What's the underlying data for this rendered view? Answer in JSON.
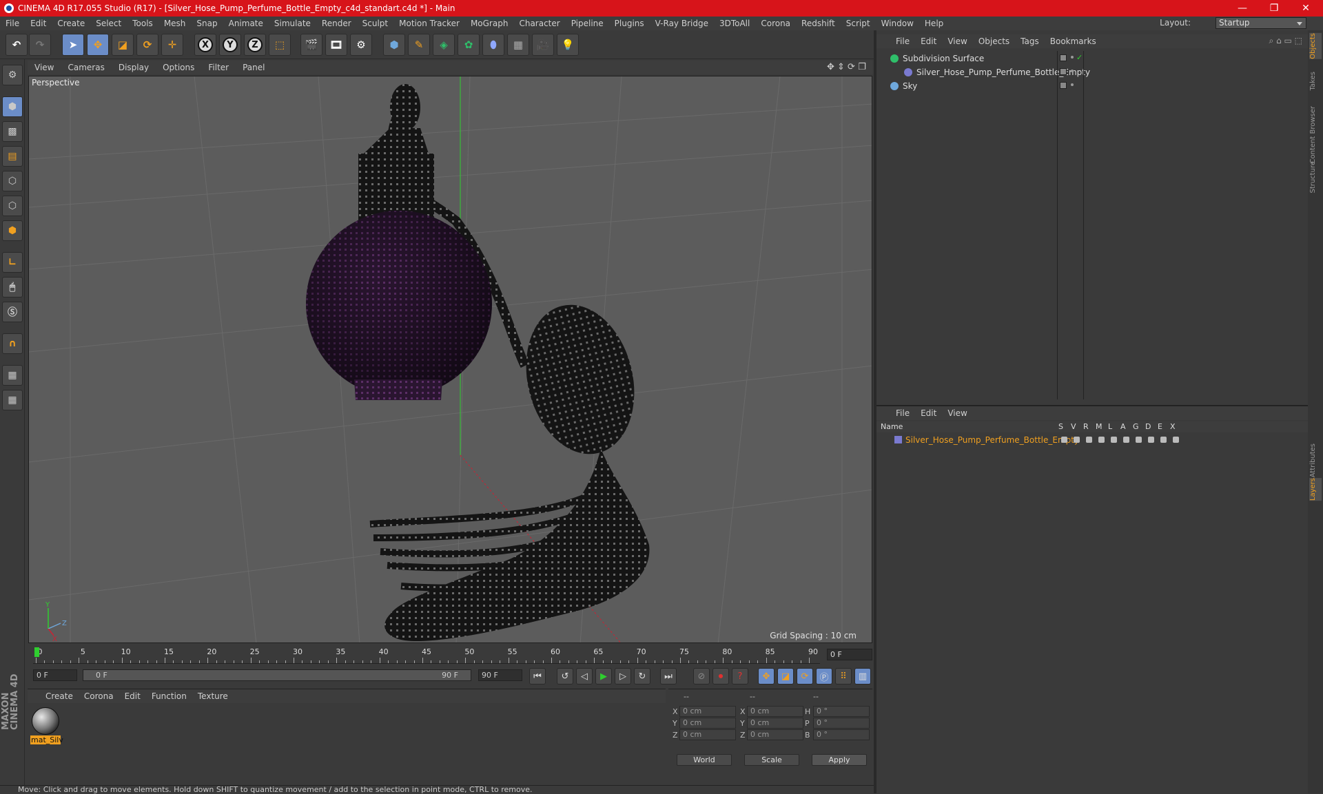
{
  "window": {
    "title": "CINEMA 4D R17.055 Studio (R17) - [Silver_Hose_Pump_Perfume_Bottle_Empty_c4d_standart.c4d *] - Main",
    "minimize": "—",
    "maximize": "❐",
    "close": "✕"
  },
  "menu": [
    "File",
    "Edit",
    "Create",
    "Select",
    "Tools",
    "Mesh",
    "Snap",
    "Animate",
    "Simulate",
    "Render",
    "Sculpt",
    "Motion Tracker",
    "MoGraph",
    "Character",
    "Pipeline",
    "Plugins",
    "V-Ray Bridge",
    "3DToAll",
    "Corona",
    "Redshift",
    "Script",
    "Window",
    "Help"
  ],
  "layout": {
    "label": "Layout:",
    "value": "Startup"
  },
  "toolbar": {
    "x_axis": "X",
    "y_axis": "Y",
    "z_axis": "Z"
  },
  "viewport": {
    "menu": [
      "View",
      "Cameras",
      "Display",
      "Options",
      "Filter",
      "Panel"
    ],
    "label": "Perspective",
    "grid_spacing": "Grid Spacing : 10 cm",
    "axis_x": "X",
    "axis_y": "Y",
    "axis_z": "Z"
  },
  "timeline": {
    "ticks": [
      "0",
      "5",
      "10",
      "15",
      "20",
      "25",
      "30",
      "35",
      "40",
      "45",
      "50",
      "55",
      "60",
      "65",
      "70",
      "75",
      "80",
      "85",
      "90"
    ],
    "current_frame": "0 F",
    "start_field": "0 F",
    "range_start": "0 F",
    "range_end": "90 F",
    "end_field": "90 F"
  },
  "material_manager": {
    "menu": [
      "Create",
      "Corona",
      "Edit",
      "Function",
      "Texture"
    ],
    "material_name": "mat_Silv"
  },
  "coordinates": {
    "header": [
      "--",
      "--",
      "--"
    ],
    "rows": [
      {
        "l1": "X",
        "v1": "0 cm",
        "l2": "X",
        "v2": "0 cm",
        "l3": "H",
        "v3": "0 °"
      },
      {
        "l1": "Y",
        "v1": "0 cm",
        "l2": "Y",
        "v2": "0 cm",
        "l3": "P",
        "v3": "0 °"
      },
      {
        "l1": "Z",
        "v1": "0 cm",
        "l2": "Z",
        "v2": "0 cm",
        "l3": "B",
        "v3": "0 °"
      }
    ],
    "mode": "World",
    "size_mode": "Scale",
    "apply": "Apply"
  },
  "status": "Move: Click and drag to move elements. Hold down SHIFT to quantize movement / add to the selection in point mode, CTRL to remove.",
  "object_manager": {
    "menu": [
      "File",
      "Edit",
      "View",
      "Objects",
      "Tags",
      "Bookmarks"
    ],
    "objects": [
      {
        "name": "Subdivision Surface",
        "icon_color": "#2fbf6a"
      },
      {
        "name": "Silver_Hose_Pump_Perfume_Bottle_Empty",
        "icon_color": "#7a7ad0"
      },
      {
        "name": "Sky",
        "icon_color": "#6fa8dc"
      }
    ]
  },
  "layer_manager": {
    "menu": [
      "File",
      "Edit",
      "View"
    ],
    "columns": [
      "Name",
      "S",
      "V",
      "R",
      "M",
      "L",
      "A",
      "G",
      "D",
      "E",
      "X"
    ],
    "layers": [
      {
        "name": "Silver_Hose_Pump_Perfume_Bottle_Empty",
        "color": "#7a7ad0"
      }
    ]
  },
  "right_tabs": [
    "Objects",
    "Takes",
    "Content Browser",
    "Structure",
    "Attributes",
    "Layers"
  ],
  "brand": "MAXON CINEMA 4D",
  "colors": {
    "accent": "#6b8dc8",
    "title_bar": "#d7141a",
    "highlight": "#f0a020"
  }
}
